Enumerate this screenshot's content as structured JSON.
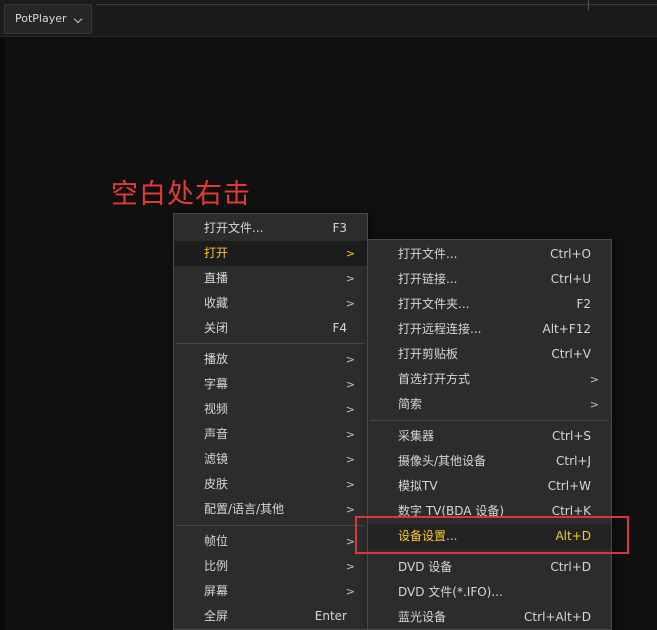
{
  "app": {
    "name": "PotPlayer"
  },
  "annotation": "空白处右击",
  "main_menu": {
    "items": [
      {
        "label": "打开文件...",
        "shortcut": "F3"
      },
      {
        "label": "打开",
        "arrow": ">"
      },
      {
        "label": "直播",
        "arrow": ">"
      },
      {
        "label": "收藏",
        "arrow": ">"
      },
      {
        "label": "关闭",
        "shortcut": "F4"
      },
      {
        "label": "播放",
        "arrow": ">"
      },
      {
        "label": "字幕",
        "arrow": ">"
      },
      {
        "label": "视频",
        "arrow": ">"
      },
      {
        "label": "声音",
        "arrow": ">"
      },
      {
        "label": "滤镜",
        "arrow": ">"
      },
      {
        "label": "皮肤",
        "arrow": ">"
      },
      {
        "label": "配置/语言/其他",
        "arrow": ">"
      },
      {
        "label": "帧位",
        "arrow": ">"
      },
      {
        "label": "比例",
        "arrow": ">"
      },
      {
        "label": "屏幕",
        "arrow": ">"
      },
      {
        "label": "全屏",
        "shortcut": "Enter"
      }
    ]
  },
  "sub_menu": {
    "items": [
      {
        "label": "打开文件...",
        "shortcut": "Ctrl+O"
      },
      {
        "label": "打开链接...",
        "shortcut": "Ctrl+U"
      },
      {
        "label": "打开文件夹...",
        "shortcut": "F2"
      },
      {
        "label": "打开远程连接...",
        "shortcut": "Alt+F12"
      },
      {
        "label": "打开剪贴板",
        "shortcut": "Ctrl+V"
      },
      {
        "label": "首选打开方式",
        "arrow": ">"
      },
      {
        "label": "简索",
        "arrow": ">"
      },
      {
        "label": "采集器",
        "shortcut": "Ctrl+S"
      },
      {
        "label": "摄像头/其他设备",
        "shortcut": "Ctrl+J"
      },
      {
        "label": "模拟TV",
        "shortcut": "Ctrl+W"
      },
      {
        "label": "数字 TV(BDA 设备)",
        "shortcut": "Ctrl+K"
      },
      {
        "label": "设备设置...",
        "shortcut": "Alt+D"
      },
      {
        "label": "DVD 设备",
        "shortcut": "Ctrl+D"
      },
      {
        "label": "DVD 文件(*.IFO)...",
        "shortcut": ""
      },
      {
        "label": "蓝光设备",
        "shortcut": "Ctrl+Alt+D"
      }
    ]
  },
  "colors": {
    "highlight_text": "#f6cb2a",
    "annotation": "#e23a35",
    "annotation_box": "#d8373b"
  }
}
